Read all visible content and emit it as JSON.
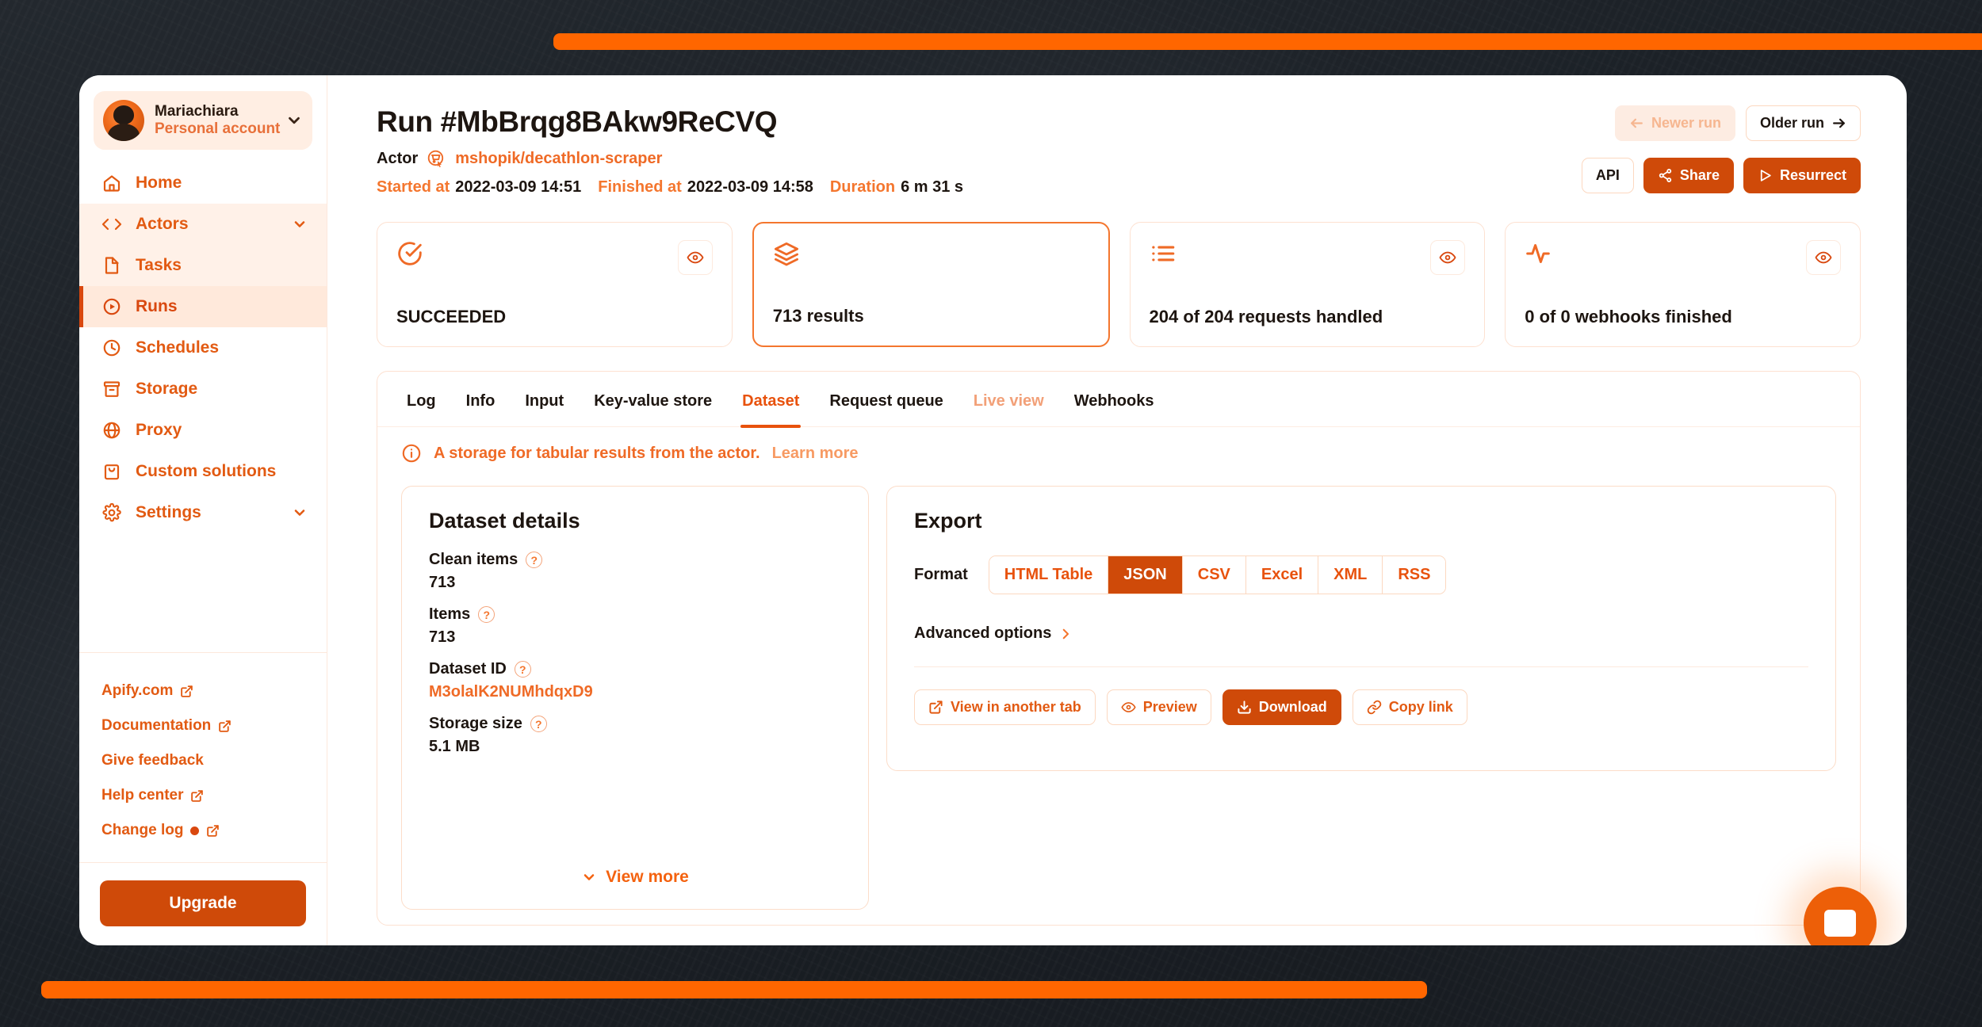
{
  "sidebar": {
    "account": {
      "name": "Mariachiara",
      "type": "Personal account",
      "avatar_icon": "user-avatar",
      "chevron_icon": "chevron-down-icon"
    },
    "items": [
      {
        "label": "Home",
        "icon": "home-icon",
        "state": "default"
      },
      {
        "label": "Actors",
        "icon": "code-brackets-icon",
        "state": "group-active",
        "chevron": "chevron-down-icon"
      },
      {
        "label": "Tasks",
        "icon": "file-icon",
        "state": "group-active"
      },
      {
        "label": "Runs",
        "icon": "play-circle-icon",
        "state": "current"
      },
      {
        "label": "Schedules",
        "icon": "clock-icon",
        "state": "default"
      },
      {
        "label": "Storage",
        "icon": "archive-box-icon",
        "state": "default"
      },
      {
        "label": "Proxy",
        "icon": "globe-icon",
        "state": "default"
      },
      {
        "label": "Custom solutions",
        "icon": "shopping-bag-icon",
        "state": "default"
      },
      {
        "label": "Settings",
        "icon": "gear-icon",
        "state": "default",
        "chevron": "chevron-down-icon"
      }
    ],
    "footer_links": [
      {
        "label": "Apify.com",
        "external": true,
        "badge": false
      },
      {
        "label": "Documentation",
        "external": true,
        "badge": false
      },
      {
        "label": "Give feedback",
        "external": false,
        "badge": false
      },
      {
        "label": "Help center",
        "external": true,
        "badge": false
      },
      {
        "label": "Change log",
        "external": true,
        "badge": true
      }
    ],
    "upgrade_label": "Upgrade"
  },
  "header": {
    "run_title": "Run #MbBrqg8BAkw9ReCVQ",
    "actor_label": "Actor",
    "actor_icon": "cart-cursor-icon",
    "actor_name": "mshopik/decathlon-scraper",
    "started_label": "Started at",
    "started_value": "2022-03-09 14:51",
    "finished_label": "Finished at",
    "finished_value": "2022-03-09 14:58",
    "duration_label": "Duration",
    "duration_value": "6 m 31 s",
    "newer_run_label": "Newer run",
    "newer_run_icon": "arrow-left-icon",
    "newer_run_disabled": true,
    "older_run_label": "Older run",
    "older_run_icon": "arrow-right-icon",
    "api_label": "API",
    "share_label": "Share",
    "share_icon": "share-nodes-icon",
    "resurrect_label": "Resurrect",
    "resurrect_icon": "play-triangle-icon"
  },
  "stat_cards": [
    {
      "label": "SUCCEEDED",
      "icon": "check-circle-icon",
      "has_eye": true,
      "selected": false
    },
    {
      "label": "713 results",
      "icon": "layers-icon",
      "has_eye": false,
      "selected": true
    },
    {
      "label": "204 of 204 requests handled",
      "icon": "list-icon",
      "has_eye": true,
      "selected": false
    },
    {
      "label": "0 of 0 webhooks finished",
      "icon": "activity-icon",
      "has_eye": true,
      "selected": false
    }
  ],
  "tabs": [
    {
      "label": "Log",
      "state": "default"
    },
    {
      "label": "Info",
      "state": "default"
    },
    {
      "label": "Input",
      "state": "default"
    },
    {
      "label": "Key-value store",
      "state": "default"
    },
    {
      "label": "Dataset",
      "state": "active"
    },
    {
      "label": "Request queue",
      "state": "default"
    },
    {
      "label": "Live view",
      "state": "muted"
    },
    {
      "label": "Webhooks",
      "state": "default"
    }
  ],
  "info_banner": {
    "icon": "info-circle-icon",
    "text": "A storage for tabular results from the actor.",
    "link_label": "Learn more"
  },
  "dataset_details": {
    "title": "Dataset details",
    "rows": [
      {
        "label": "Clean items",
        "value": "713",
        "help": true,
        "is_link": false
      },
      {
        "label": "Items",
        "value": "713",
        "help": true,
        "is_link": false
      },
      {
        "label": "Dataset ID",
        "value": "M3olalK2NUMhdqxD9",
        "help": true,
        "is_link": true
      },
      {
        "label": "Storage size",
        "value": "5.1 MB",
        "help": true,
        "is_link": false
      }
    ],
    "view_more_label": "View more",
    "view_more_icon": "chevron-down-icon"
  },
  "export": {
    "title": "Export",
    "format_label": "Format",
    "formats": [
      {
        "label": "HTML Table",
        "selected": false
      },
      {
        "label": "JSON",
        "selected": true
      },
      {
        "label": "CSV",
        "selected": false
      },
      {
        "label": "Excel",
        "selected": false
      },
      {
        "label": "XML",
        "selected": false
      },
      {
        "label": "RSS",
        "selected": false
      }
    ],
    "advanced_options_label": "Advanced options",
    "advanced_options_icon": "chevron-right-icon",
    "actions": [
      {
        "label": "View in another tab",
        "icon": "external-link-icon",
        "style": "outline-orange"
      },
      {
        "label": "Preview",
        "icon": "eye-icon",
        "style": "outline-orange"
      },
      {
        "label": "Download",
        "icon": "download-icon",
        "style": "filled"
      },
      {
        "label": "Copy link",
        "icon": "link-icon",
        "style": "outline-orange"
      }
    ]
  },
  "chat_widget": {
    "icon": "chat-bubble-icon"
  },
  "colors": {
    "brand_orange": "#f60",
    "accent_dark": "#cf4a09",
    "accent": "#e8520d",
    "accent_light": "#ef6a26",
    "surface": "#ffffff",
    "surface_tint": "#ffeee3",
    "border": "#fde1d1",
    "text_dark": "#1d1510",
    "backdrop": "#1b2026"
  }
}
